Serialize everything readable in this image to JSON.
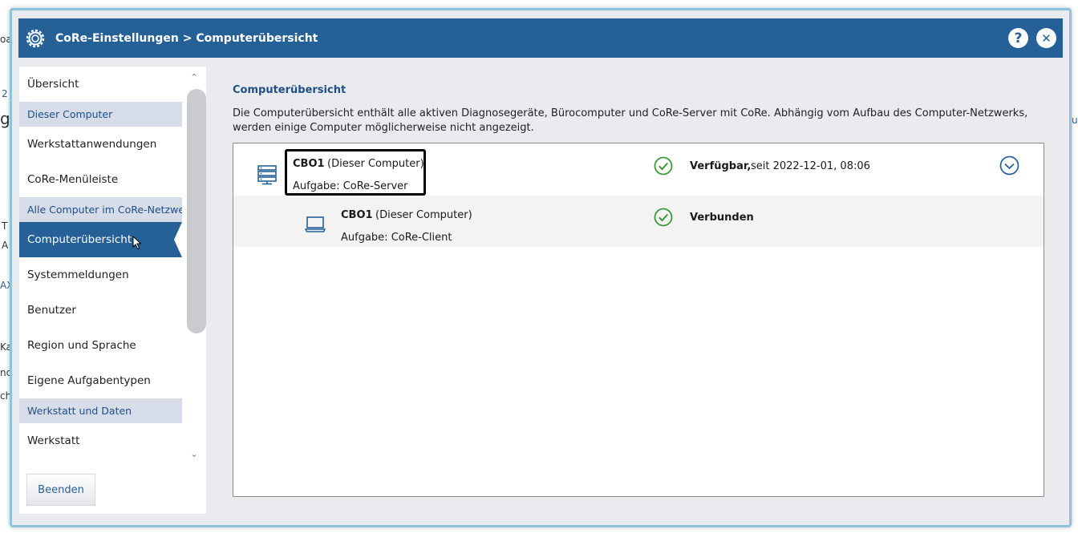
{
  "background": {
    "fragments": [
      "2",
      "g",
      "T",
      "A",
      "AX",
      "Ka",
      "nc",
      "ch",
      "u",
      "oa"
    ]
  },
  "dialog": {
    "breadcrumb": "CoRe-Einstellungen > Computerübersicht",
    "help_label": "?",
    "close_label": "✕"
  },
  "sidebar": {
    "items": [
      {
        "type": "item",
        "label": "Übersicht"
      },
      {
        "type": "section",
        "label": "Dieser Computer"
      },
      {
        "type": "item",
        "label": "Werkstattanwendungen"
      },
      {
        "type": "item",
        "label": "CoRe-Menüleiste"
      },
      {
        "type": "section",
        "label": "Alle Computer im CoRe-Netzwerk"
      },
      {
        "type": "item",
        "label": "Computerübersicht",
        "active": true
      },
      {
        "type": "item",
        "label": "Systemmeldungen"
      },
      {
        "type": "item",
        "label": "Benutzer"
      },
      {
        "type": "item",
        "label": "Region und Sprache"
      },
      {
        "type": "item",
        "label": "Eigene Aufgabentypen"
      },
      {
        "type": "section",
        "label": "Werkstatt und Daten"
      },
      {
        "type": "item",
        "label": "Werkstatt"
      }
    ],
    "exit_button": "Beenden"
  },
  "main": {
    "title": "Computerübersicht",
    "description": "Die Computerübersicht enthält alle aktiven Diagnosegeräte, Bürocomputer und CoRe-Server mit CoRe. Abhängig vom Aufbau des Computer-Netzwerks, werden einige Computer möglicherweise nicht angezeigt.",
    "computers": [
      {
        "name": "CBO1",
        "suffix": "(Dieser Computer)",
        "role": "Aufgabe: CoRe-Server",
        "status": "Verfügbar,",
        "status_detail": "seit 2022-12-01, 08:06",
        "icon": "server-icon"
      },
      {
        "name": "CBO1",
        "suffix": "(Dieser Computer)",
        "role": "Aufgabe: CoRe-Client",
        "status": "Verbunden",
        "status_detail": "",
        "icon": "laptop-icon"
      }
    ]
  },
  "colors": {
    "primary": "#256197",
    "section_bg": "#d6dde8",
    "success": "#3a9a3a"
  }
}
